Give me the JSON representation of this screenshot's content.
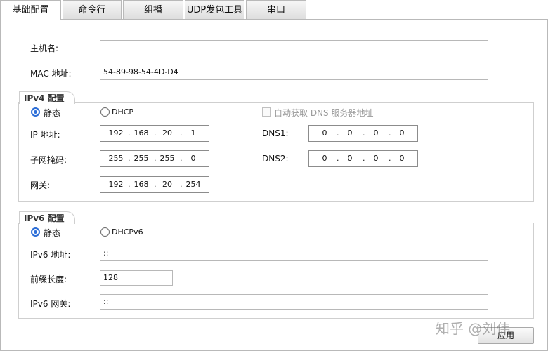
{
  "tabs": [
    {
      "label": "基础配置",
      "active": true
    },
    {
      "label": "命令行",
      "active": false
    },
    {
      "label": "组播",
      "active": false
    },
    {
      "label": "UDP发包工具",
      "active": false
    },
    {
      "label": "串口",
      "active": false
    }
  ],
  "basic": {
    "hostname_label": "主机名:",
    "hostname_value": "",
    "mac_label": "MAC 地址:",
    "mac_value": "54-89-98-54-4D-D4"
  },
  "ipv4": {
    "legend": "IPv4 配置",
    "static_label": "静态",
    "dhcp_label": "DHCP",
    "mode": "static",
    "auto_dns_label": "自动获取 DNS 服务器地址",
    "ip_label": "IP 地址:",
    "ip": [
      "192",
      "168",
      "20",
      "1"
    ],
    "mask_label": "子网掩码:",
    "mask": [
      "255",
      "255",
      "255",
      "0"
    ],
    "gateway_label": "网关:",
    "gateway": [
      "192",
      "168",
      "20",
      "254"
    ],
    "dns1_label": "DNS1:",
    "dns1": [
      "0",
      "0",
      "0",
      "0"
    ],
    "dns2_label": "DNS2:",
    "dns2": [
      "0",
      "0",
      "0",
      "0"
    ]
  },
  "ipv6": {
    "legend": "IPv6 配置",
    "static_label": "静态",
    "dhcp_label": "DHCPv6",
    "mode": "static",
    "ip_label": "IPv6 地址:",
    "ip_value": "::",
    "prefix_label": "前缀长度:",
    "prefix_value": "128",
    "gateway_label": "IPv6 网关:",
    "gateway_value": "::"
  },
  "apply_label": "应用",
  "watermark": "知乎 @刘伟"
}
